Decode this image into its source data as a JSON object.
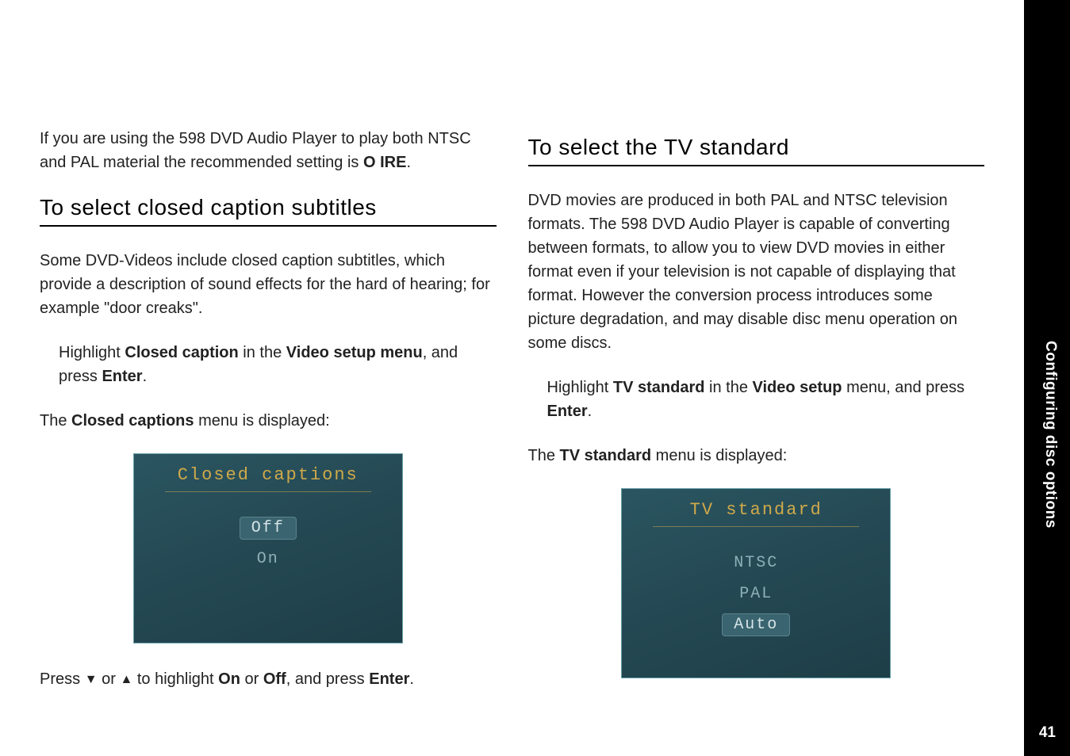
{
  "left": {
    "intro": "If you are using the 598 DVD Audio Player to play both NTSC and PAL material the recommended setting is ",
    "intro_bold": "O IRE",
    "intro_end": ".",
    "h2": "To select closed caption subtitles",
    "p1": "Some DVD-Videos include closed caption subtitles, which provide a description of sound effects for the hard of hearing; for example \"door creaks\".",
    "step_pre": "Highlight ",
    "step_b1": "Closed caption",
    "step_mid": " in the ",
    "step_b2": "Video setup menu",
    "step_post": ", and press ",
    "step_b3": "Enter",
    "step_end": ".",
    "p2_pre": "The ",
    "p2_b": "Closed captions",
    "p2_post": " menu is displayed:",
    "menu": {
      "title": "Closed captions",
      "items": [
        "Off",
        "On"
      ],
      "selected": 0
    },
    "press_pre": "Press ",
    "arrow_down": "▼",
    "press_or": " or ",
    "arrow_up": "▲",
    "press_mid": " to highlight ",
    "on": "On",
    "or2": " or ",
    "off": "Off",
    "press_post": ", and press ",
    "enter": "Enter",
    "press_end": "."
  },
  "right": {
    "h2": "To select the TV standard",
    "p1": "DVD movies are produced in both PAL and NTSC television formats. The 598 DVD Audio Player is capable of converting between formats, to allow you to view DVD movies in either format even if your television is not capable of displaying that format. However the conversion process introduces some picture degradation, and may disable disc menu operation on some discs.",
    "step_pre": "Highlight ",
    "step_b1": "TV standard",
    "step_mid": " in the ",
    "step_b2": "Video setup",
    "step_post": " menu, and press ",
    "step_b3": "Enter",
    "step_end": ".",
    "p2_pre": "The ",
    "p2_b": "TV standard",
    "p2_post": " menu is displayed:",
    "menu": {
      "title": "TV standard",
      "items": [
        "NTSC",
        "PAL",
        "Auto"
      ],
      "selected": 2
    }
  },
  "side": {
    "label": "Configuring disc options",
    "page": "41"
  }
}
